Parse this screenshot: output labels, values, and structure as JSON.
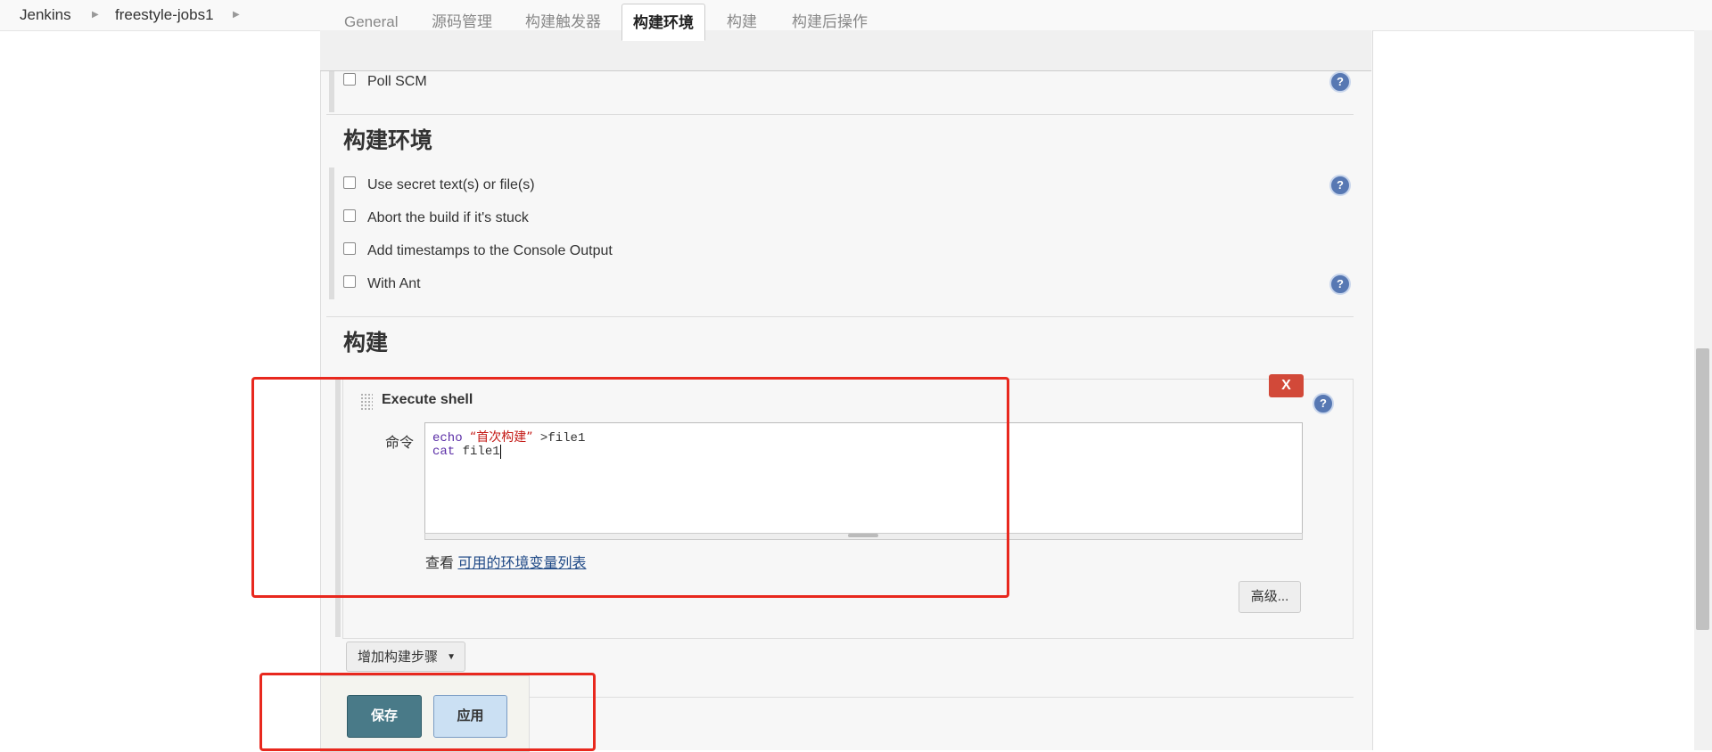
{
  "breadcrumb": {
    "items": [
      "Jenkins",
      "freestyle-jobs1"
    ]
  },
  "tabs": [
    "General",
    "源码管理",
    "构建触发器",
    "构建环境",
    "构建",
    "构建后操作"
  ],
  "active_tab": "构建环境",
  "triggers": {
    "poll_scm": "Poll SCM"
  },
  "build_env": {
    "title": "构建环境",
    "options": [
      "Use secret text(s) or file(s)",
      "Abort the build if it's stuck",
      "Add timestamps to the Console Output",
      "With Ant"
    ]
  },
  "build": {
    "title": "构建",
    "step_title": "Execute shell",
    "delete_label": "X",
    "command_label": "命令",
    "command_lines": {
      "line1_kw": "echo",
      "line1_str": "“首次构建”",
      "line1_rest": " >file1",
      "line2_kw": "cat",
      "line2_rest": " file1"
    },
    "env_prefix": "查看",
    "env_link": "可用的环境变量列表",
    "advanced_label": "高级...",
    "add_step_label": "增加构建步骤"
  },
  "actions": {
    "save_label": "保存",
    "apply_label": "应用"
  },
  "help_glyph": "?",
  "colors": {
    "annotation": "#e8281e",
    "save_button": "#497a88",
    "apply_button": "#cbe0f3",
    "delete_button": "#d24939",
    "help_icon": "#5778b3"
  }
}
